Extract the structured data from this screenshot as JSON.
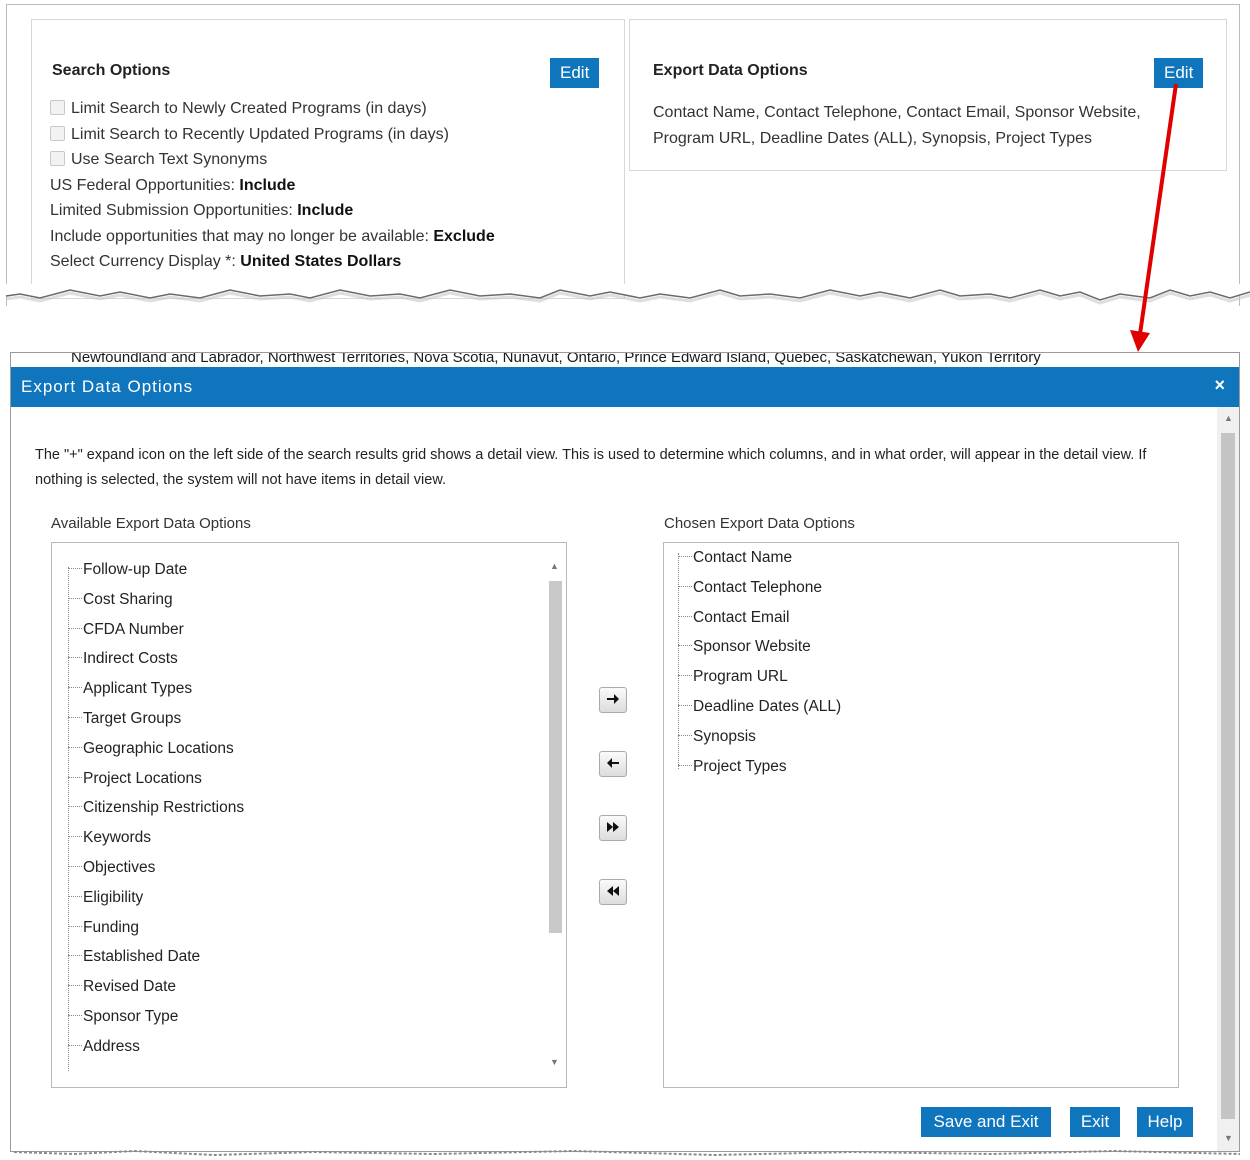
{
  "search_options": {
    "title": "Search Options",
    "edit_label": "Edit",
    "checkboxes": [
      "Limit Search to Newly Created Programs (in days)",
      "Limit Search to Recently Updated Programs (in days)",
      "Use Search Text Synonyms"
    ],
    "settings": [
      {
        "label": "US Federal Opportunities: ",
        "value": "Include"
      },
      {
        "label": "Limited Submission Opportunities: ",
        "value": "Include"
      },
      {
        "label": "Include opportunities that may no longer be available: ",
        "value": "Exclude"
      },
      {
        "label": "Select Currency Display *: ",
        "value": "United States Dollars"
      }
    ]
  },
  "export_options": {
    "title": "Export Data Options",
    "edit_label": "Edit",
    "summary": "Contact Name, Contact Telephone, Contact Email, Sponsor Website, Program URL, Deadline Dates (ALL), Synopsis, Project Types"
  },
  "background_text": "Newfoundland and Labrador, Northwest Territories, Nova Scotia, Nunavut, Ontario, Prince Edward Island, Quebec, Saskatchewan, Yukon Territory",
  "dialog": {
    "title": "Export Data Options",
    "close_glyph": "×",
    "description": "The \"+\" expand icon on the left side of the search results grid shows a detail view. This is used to determine which columns, and in what order, will appear in the detail view. If nothing is selected, the system will not have items in detail view.",
    "available_label": "Available Export Data Options",
    "chosen_label": "Chosen Export Data Options",
    "available_items": [
      "Follow-up Date",
      "Cost Sharing",
      "CFDA Number",
      "Indirect Costs",
      "Applicant Types",
      "Target Groups",
      "Geographic Locations",
      "Project Locations",
      "Citizenship Restrictions",
      "Keywords",
      "Objectives",
      "Eligibility",
      "Funding",
      "Established Date",
      "Revised Date",
      "Sponsor Type",
      "Address"
    ],
    "chosen_items": [
      "Contact Name",
      "Contact Telephone",
      "Contact Email",
      "Sponsor Website",
      "Program URL",
      "Deadline Dates (ALL)",
      "Synopsis",
      "Project Types"
    ],
    "move_buttons": {
      "add": "➔",
      "remove": "🡐",
      "add_all": "⏵⏵",
      "remove_all": "⏴⏴"
    },
    "buttons": {
      "save_exit": "Save and Exit",
      "exit": "Exit",
      "help": "Help"
    }
  },
  "colors": {
    "accent": "#0f75bc",
    "arrow": "#e00000"
  }
}
